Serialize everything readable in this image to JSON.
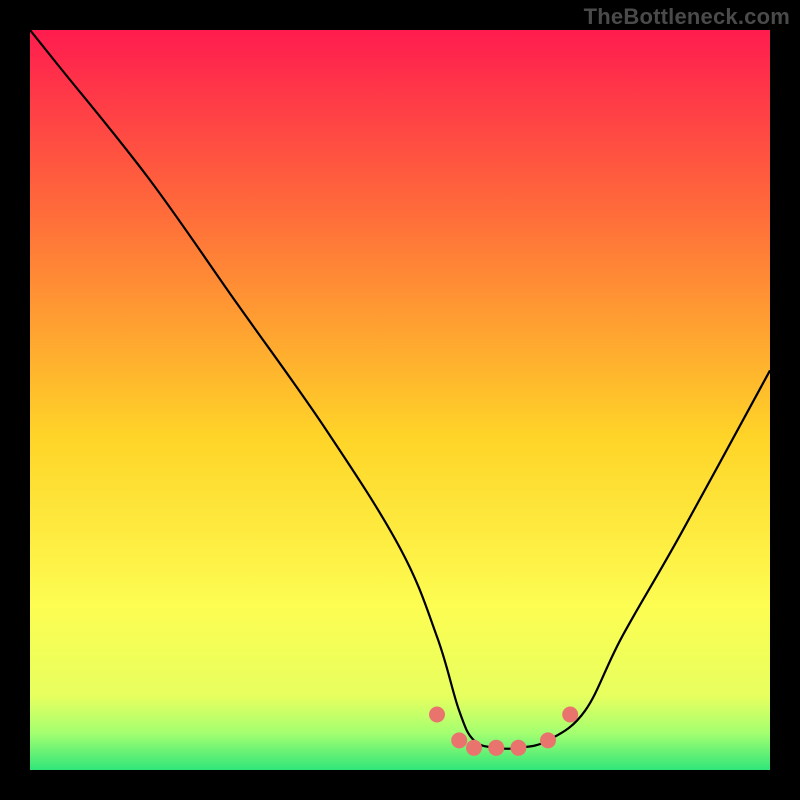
{
  "watermark": "TheBottleneck.com",
  "chart_data": {
    "type": "line",
    "title": "",
    "xlabel": "",
    "ylabel": "",
    "xlim": [
      0,
      100
    ],
    "ylim": [
      0,
      100
    ],
    "series": [
      {
        "name": "bottleneck-curve",
        "x": [
          0,
          4,
          16,
          28,
          40,
          50,
          55,
          58,
          60,
          63,
          66,
          70,
          75,
          80,
          88,
          100
        ],
        "values": [
          100,
          95,
          80,
          63,
          46,
          30,
          18,
          8,
          4,
          3,
          3,
          4,
          8,
          18,
          32,
          54
        ]
      },
      {
        "name": "optimal-markers",
        "x": [
          55,
          58,
          60,
          63,
          66,
          70,
          73
        ],
        "values": [
          7.5,
          4,
          3,
          3,
          3,
          4,
          7.5
        ]
      }
    ],
    "gradient_stops": [
      {
        "pct": 0,
        "color": "#ff1c4f"
      },
      {
        "pct": 25,
        "color": "#ff6d3a"
      },
      {
        "pct": 55,
        "color": "#ffd428"
      },
      {
        "pct": 78,
        "color": "#fdfd52"
      },
      {
        "pct": 90,
        "color": "#e7ff5f"
      },
      {
        "pct": 95,
        "color": "#a4ff70"
      },
      {
        "pct": 100,
        "color": "#30e57a"
      }
    ],
    "marker_style": {
      "color": "#e9746e",
      "radius_px": 8
    }
  }
}
